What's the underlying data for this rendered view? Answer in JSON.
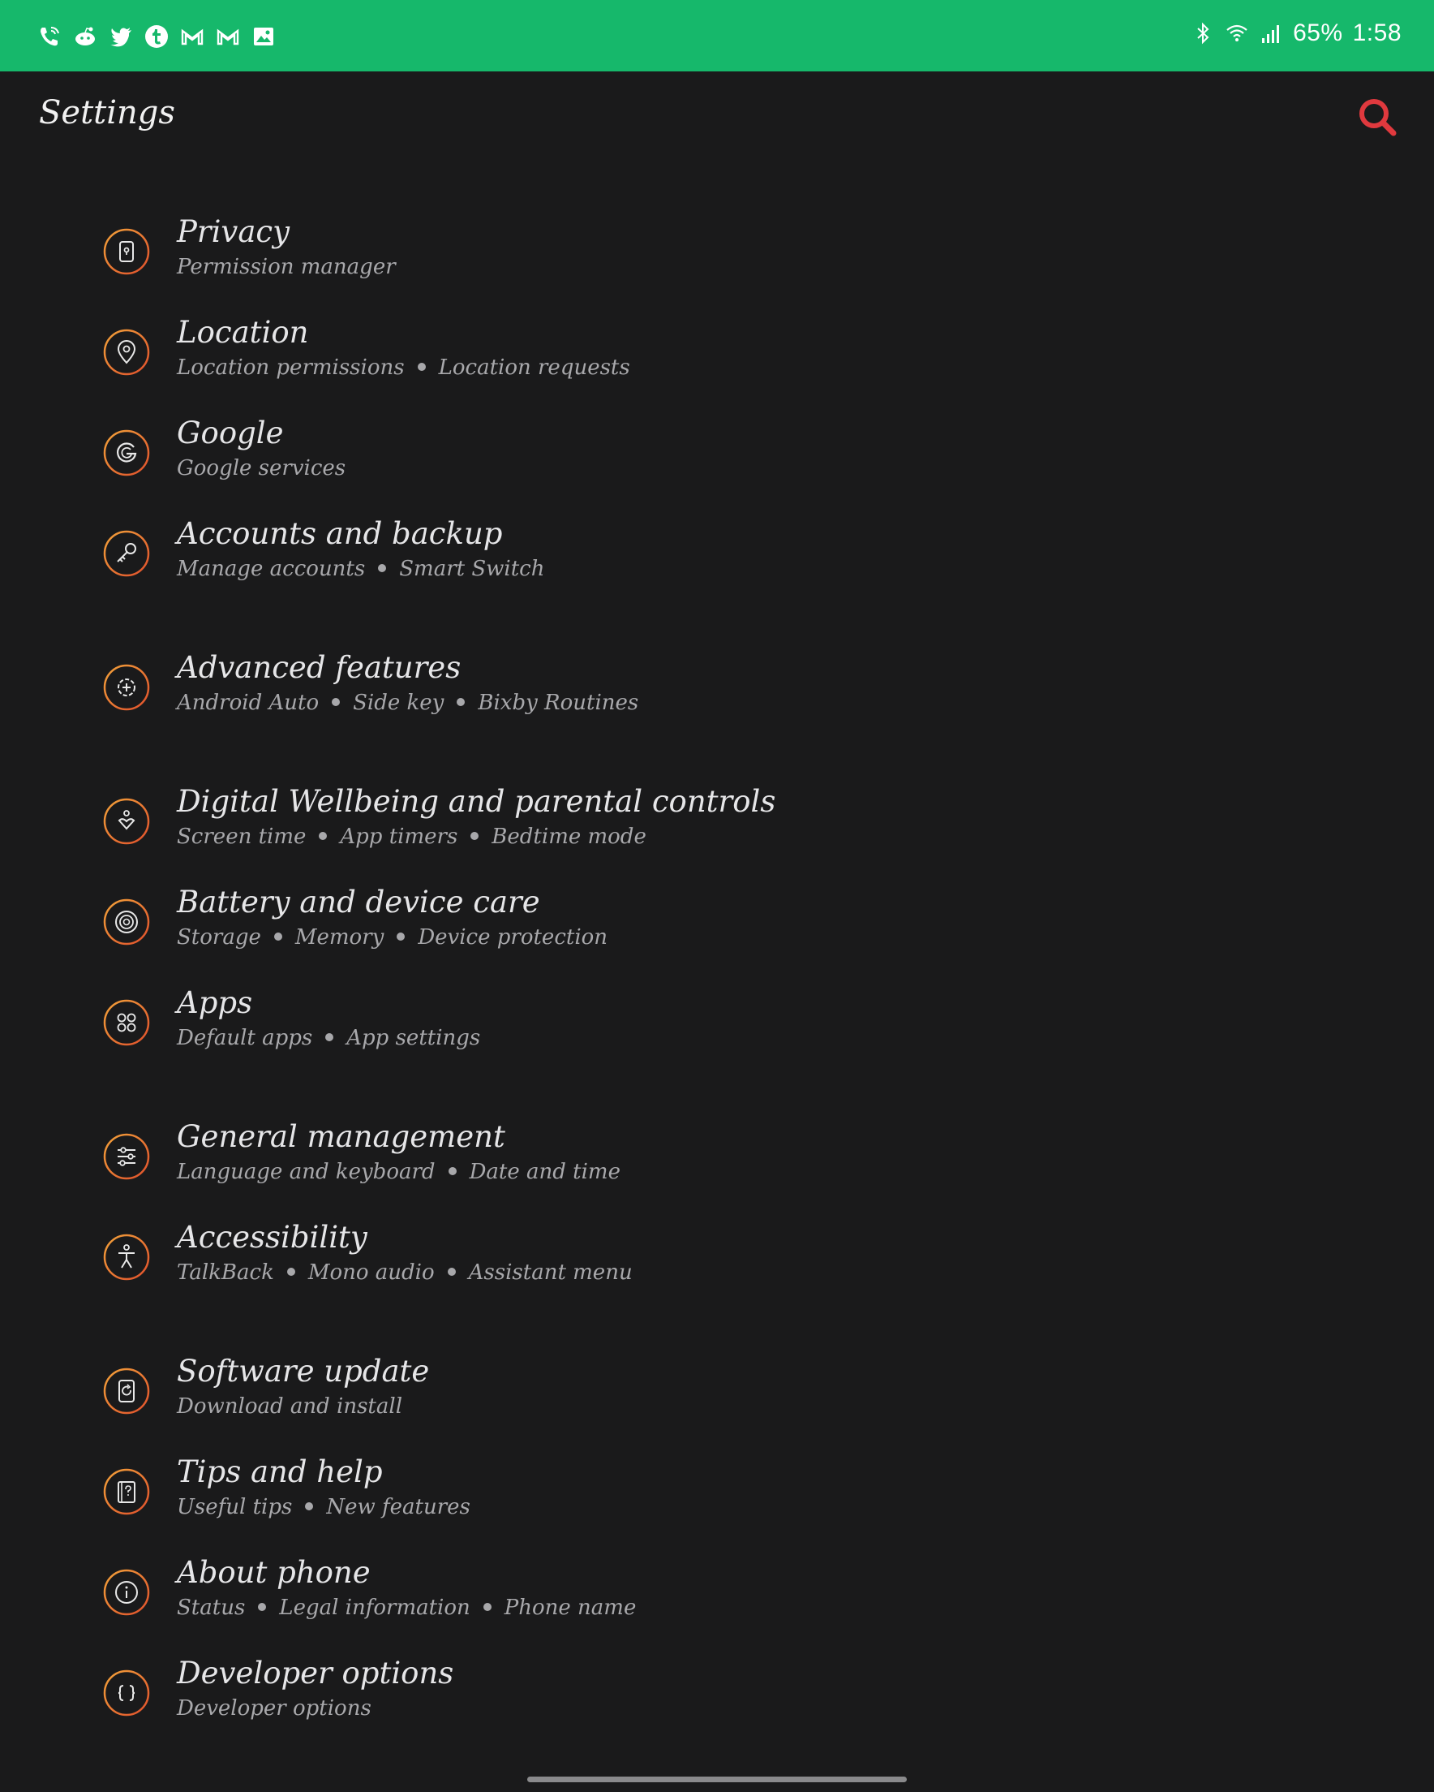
{
  "status_bar": {
    "left_icons": [
      "phone-wifi-icon",
      "reddit-icon",
      "twitter-icon",
      "tumblr-icon",
      "gmail-icon",
      "gmail-icon",
      "gallery-icon"
    ],
    "right_icons": [
      "bluetooth-icon",
      "wifi-icon",
      "signal-icon"
    ],
    "battery": "65%",
    "time": "1:58",
    "background": "#16b86b"
  },
  "header": {
    "title": "Settings",
    "search_icon": "search-icon",
    "accent": "#e0393e"
  },
  "settings_items": [
    {
      "name": "privacy",
      "icon": "privacy-icon",
      "title": "Privacy",
      "subtitle": [
        "Permission manager"
      ]
    },
    {
      "name": "location",
      "icon": "location-pin-icon",
      "title": "Location",
      "subtitle": [
        "Location permissions",
        "Location requests"
      ]
    },
    {
      "name": "google",
      "icon": "google-icon",
      "title": "Google",
      "subtitle": [
        "Google services"
      ]
    },
    {
      "name": "accounts-backup",
      "icon": "key-icon",
      "title": "Accounts and backup",
      "subtitle": [
        "Manage accounts",
        "Smart Switch"
      ]
    },
    {
      "name": "advanced-features",
      "icon": "advanced-gear-icon",
      "title": "Advanced features",
      "subtitle": [
        "Android Auto",
        "Side key",
        "Bixby Routines"
      ]
    },
    {
      "name": "digital-wellbeing",
      "icon": "wellbeing-icon",
      "title": "Digital Wellbeing and parental controls",
      "subtitle": [
        "Screen time",
        "App timers",
        "Bedtime mode"
      ]
    },
    {
      "name": "battery-device-care",
      "icon": "device-care-icon",
      "title": "Battery and device care",
      "subtitle": [
        "Storage",
        "Memory",
        "Device protection"
      ]
    },
    {
      "name": "apps",
      "icon": "apps-grid-icon",
      "title": "Apps",
      "subtitle": [
        "Default apps",
        "App settings"
      ]
    },
    {
      "name": "general-management",
      "icon": "sliders-icon",
      "title": "General management",
      "subtitle": [
        "Language and keyboard",
        "Date and time"
      ]
    },
    {
      "name": "accessibility",
      "icon": "accessibility-icon",
      "title": "Accessibility",
      "subtitle": [
        "TalkBack",
        "Mono audio",
        "Assistant menu"
      ]
    },
    {
      "name": "software-update",
      "icon": "software-update-icon",
      "title": "Software update",
      "subtitle": [
        "Download and install"
      ]
    },
    {
      "name": "tips-help",
      "icon": "tips-help-icon",
      "title": "Tips and help",
      "subtitle": [
        "Useful tips",
        "New features"
      ]
    },
    {
      "name": "about-phone",
      "icon": "info-icon",
      "title": "About phone",
      "subtitle": [
        "Status",
        "Legal information",
        "Phone name"
      ]
    },
    {
      "name": "developer-options",
      "icon": "braces-icon",
      "title": "Developer options",
      "subtitle": [
        "Developer options"
      ]
    }
  ],
  "colors": {
    "background": "#1a1a1b",
    "icon_ring_outer": "#e0502c",
    "icon_ring_inner": "#f2a23a",
    "title_text": "#e6e6e8",
    "subtitle_text": "#a8a8ab"
  }
}
